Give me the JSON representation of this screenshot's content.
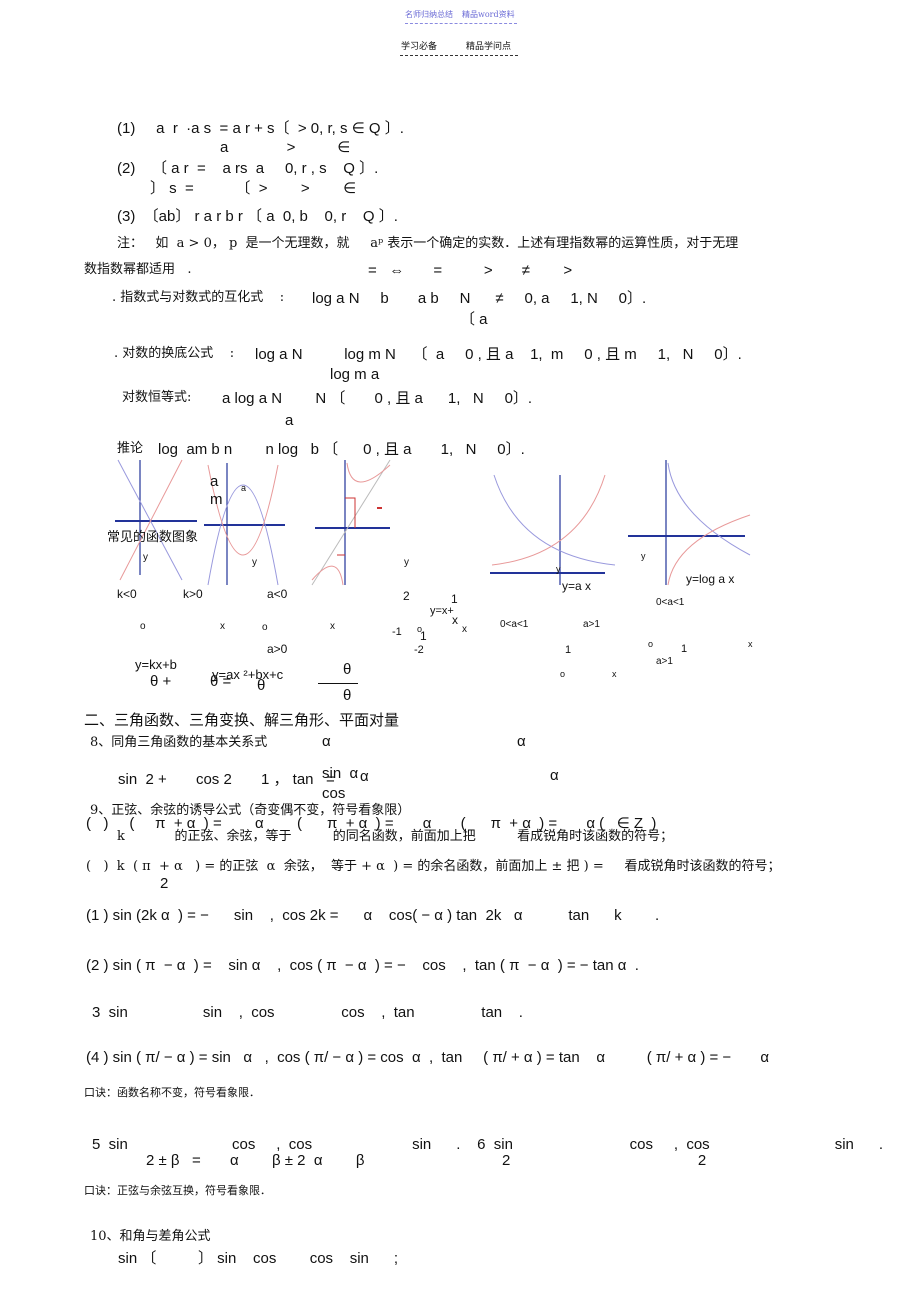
{
  "header": {
    "watermark_left": "名师归纳总结",
    "watermark_right": "精品word资料",
    "subtitle_left": "学习必备",
    "subtitle_right": "精品学问点",
    "watermark_color": "#6b6bd6"
  },
  "section1": {
    "f1": "(1)     a  r  ·a s  = a r + s〔  > 0, r, s ∈ Q 〕.",
    "f2_top": "a              >          ∈",
    "f2": "(2)    〔 a r  =    a rs  a     0, r , s    Q 〕.",
    "f2_bot": "〕 s  =          〔  >        >        ∈",
    "f3": "(3)  〔ab〕 r a r b r 〔 a  0, b    0, r    Q 〕.",
    "note": "注：   如  a > 0， p  是一个无理数，就     aᵖ 表示一个确定的实数．上述有理指数幂的运算性质，对于无理",
    "note2": "数指数幂都适用   .",
    "note2_syms": "=   ⇔       =          >       ≠        >",
    "conv_label": ". 指数式与对数式的互化式    :",
    "conv": "log a N     b       a b     N      ≠     0, a     1, N     0〕.",
    "conv_sub": "〔 a",
    "change_label": ". 对数的换底公式    :",
    "change": "log a N          log m N    〔  a     0 , 且 a    1,  m     0 , 且 m     1,   N     0〕.",
    "change_den": "log m a",
    "identity_label": "对数恒等式:",
    "identity": "a log a N        N 〔       0 , 且 a      1,   N     0〕.",
    "identity_sub": "a",
    "corollary_label": "推论",
    "corollary": "log  am b n        n log   b 〔      0 , 且 a       1,   N     0〕.",
    "graphs_title": "常见的函数图象"
  },
  "graph_labels": {
    "g1": [
      "k<0",
      "k>0",
      "o",
      "x",
      "y",
      "y=kx+b"
    ],
    "g2": [
      "a<0",
      "a>0",
      "o",
      "x",
      "y",
      "a",
      "a",
      "m",
      "y=ax ²+bx+c"
    ],
    "g3": [
      "2",
      "1",
      "y=x+",
      "x",
      "x",
      "-1",
      "o",
      "1",
      "-2",
      "y"
    ],
    "g4": [
      "y=a x",
      "0<a<1",
      "a>1",
      "1",
      "o",
      "x",
      "y"
    ],
    "g5": [
      "y=log a x",
      "0<a<1",
      "a>1",
      "1",
      "o",
      "x",
      "y"
    ],
    "thetas": [
      "θ +",
      "θ =",
      "θ",
      "θ",
      "θ"
    ]
  },
  "section2": {
    "title": "二、三角函数、三角变换、解三角形、平面对量",
    "item8": "8、同角三角函数的基本关系式",
    "item8_alpha": [
      "α",
      "α",
      "α",
      "α"
    ],
    "pythag": "sin  2 +       cos 2       1 ， tan   =",
    "tan_num": "sin  α",
    "tan_den": "cos",
    "item9": "9、正弦、余弦的诱导公式（奇变偶不变，符号看象限）",
    "r9a": "(   )     (     π  + α  ) =        α        (      π  + α  ) =       α       (      π  + α  ) =       α (   ∈ Z  )",
    "r9a2": "k            的正弦、余弦，等于          的同名函数，前面加上把          看成锐角时该函数的符号；",
    "r9b": "(   )  k  ( π  + α   ) = 的正弦  α  余弦，  等于 + α  ) = 的余名函数，前面加上 ± 把 ) =     看成锐角时该函数的符号；",
    "r9b_sub": "2",
    "l1": "(1 ) sin (2k α  ) = −      sin    ,  cos 2k =      α    cos( − α ) tan  2k   α           tan      k        .",
    "l2": "(2 ) sin ( π  − α  ) =    sin α    ,  cos ( π  − α  ) = −    cos    ,  tan ( π  − α  ) = − tan α  .",
    "l3": "3  sin                  sin    ,  cos                cos    ,  tan                tan    .",
    "l4": "(4 ) sin ( π/ − α ) = sin   α   ,  cos ( π/ − α ) = cos  α  ,  tan     ( π/ + α ) = tan    α          ( π/ + α ) = −       α",
    "mnemonic1": "口诀：函数名称不变，符号看象限．",
    "l5": "5  sin                         cos     ,  cos                        sin      .    6  sin                            cos     ,  cos                              sin      .",
    "l5_sub": "2 ± β   =       α        β ± 2  α        β                                 2                                             2",
    "mnemonic2": "口诀：正弦与余弦互换，符号看象限．",
    "item10": "10、和角与差角公式",
    "sum": "sin 〔          〕 sin    cos        cos    sin      ;"
  }
}
